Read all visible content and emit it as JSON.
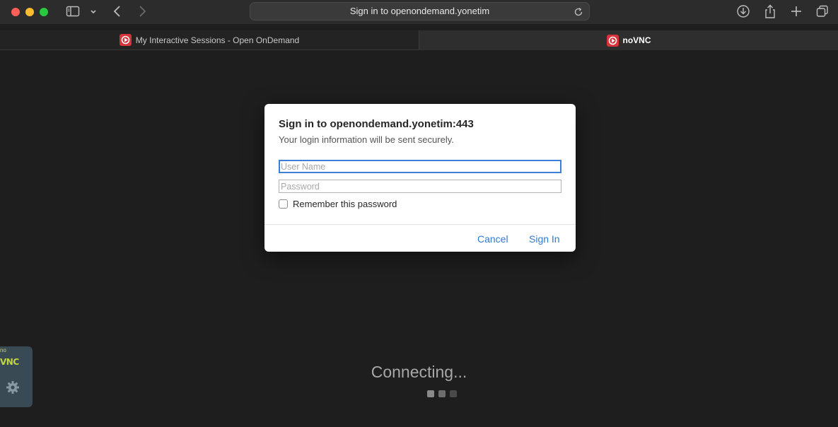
{
  "browser": {
    "address_text": "Sign in to openondemand.yonetim",
    "tabs": [
      {
        "label": "My Interactive Sessions - Open OnDemand",
        "active": false
      },
      {
        "label": "noVNC",
        "active": true
      }
    ]
  },
  "dialog": {
    "title": "Sign in to openondemand.yonetim:443",
    "subtitle": "Your login information will be sent securely.",
    "username_placeholder": "User Name",
    "password_placeholder": "Password",
    "remember_label": "Remember this password",
    "remember_checked": false,
    "cancel_label": "Cancel",
    "signin_label": "Sign In"
  },
  "novnc": {
    "logo_text": "VNC",
    "logo_small": "no",
    "status_text": "Connecting..."
  },
  "colors": {
    "accent": "#2f79d6",
    "favicon": "#d8323a",
    "novnc_logo": "#c5d83a"
  }
}
